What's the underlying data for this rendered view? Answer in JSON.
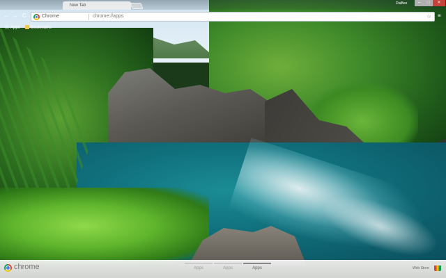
{
  "window": {
    "tab_title": "New Tab",
    "user_label": "DiaBee",
    "min_glyph": "–",
    "max_glyph": "□",
    "close_glyph": "✕"
  },
  "toolbar": {
    "back_glyph": "←",
    "forward_glyph": "→",
    "reload_glyph": "C",
    "scheme": "Chrome",
    "url": "chrome://apps",
    "star_glyph": "☆",
    "menu_glyph": "≡"
  },
  "bookmarks": {
    "items": [
      {
        "label": "Apps",
        "icon": "apps-grid-icon"
      },
      {
        "label": "Bookmarks",
        "icon": "folder-icon"
      }
    ]
  },
  "bottom": {
    "brand": "chrome",
    "pages": [
      "Apps",
      "Apps",
      "Apps"
    ],
    "active_page": 2,
    "webstore_label": "Web Store"
  },
  "colors": {
    "close_button": "#c8413b",
    "water": "#10717d",
    "foliage": "#5fb52c"
  }
}
